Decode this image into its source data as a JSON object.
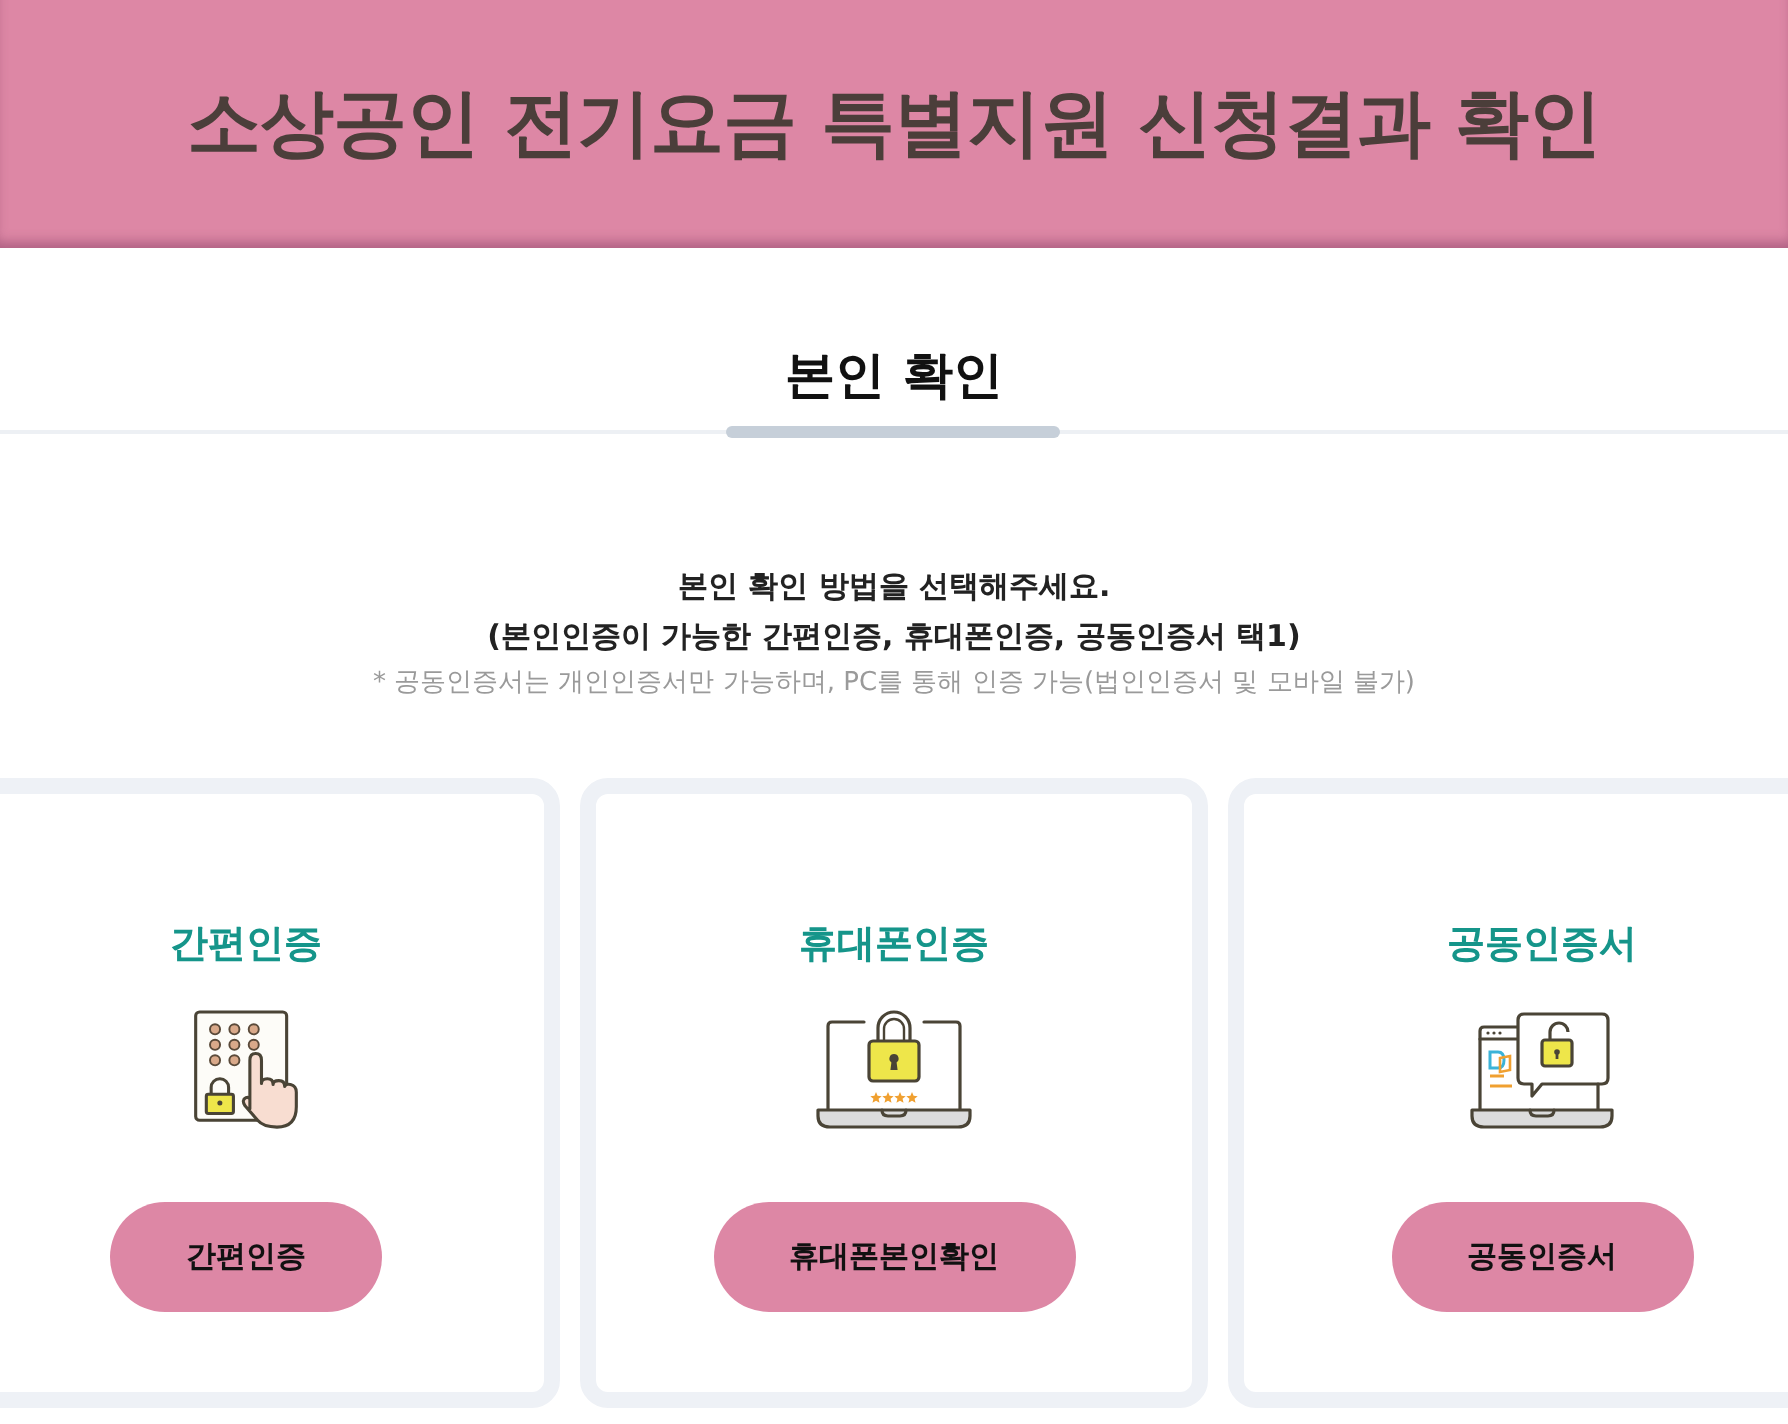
{
  "header": {
    "title": "소상공인 전기요금 특별지원 신청결과 확인"
  },
  "section": {
    "title": "본인 확인"
  },
  "instructions": {
    "lines": [
      "본인 확인 방법을 선택해주세요.",
      "(본인인증이 가능한 간편인증, 휴대폰인증, 공동인증서 택1)"
    ],
    "note": "* 공동인증서는 개인인증서만 가능하며, PC를 통해 인증 가능(법인인증서 및 모바일 불가)"
  },
  "methods": [
    {
      "kind": "simple",
      "title": "간편인증",
      "button": "간편인증"
    },
    {
      "kind": "phone",
      "title": "휴대폰인증",
      "button": "휴대폰본인확인"
    },
    {
      "kind": "certificate",
      "title": "공동인증서",
      "button": "공동인증서"
    }
  ]
}
